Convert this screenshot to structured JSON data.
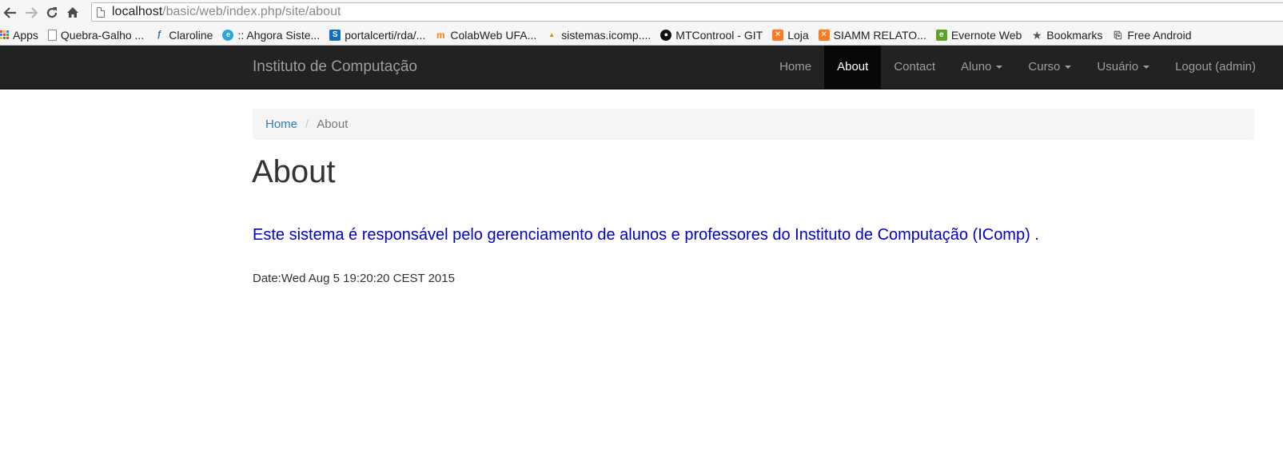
{
  "browser": {
    "url_host": "localhost",
    "url_path": "/basic/web/index.php/site/about",
    "nav_icons": [
      "back-arrow-icon",
      "forward-arrow-icon",
      "reload-icon",
      "home-icon"
    ]
  },
  "bookmarks": [
    {
      "label": "Apps",
      "icon": "apps-grid-icon"
    },
    {
      "label": "Quebra-Galho ...",
      "icon": "document-icon"
    },
    {
      "label": "Claroline",
      "icon": "claroline-icon"
    },
    {
      "label": ":: Ahgora Siste...",
      "icon": "ahgora-icon"
    },
    {
      "label": "portalcerti/rda/...",
      "icon": "sharepoint-icon"
    },
    {
      "label": "ColabWeb UFA...",
      "icon": "moodle-icon"
    },
    {
      "label": "sistemas.icomp....",
      "icon": "phpmyadmin-icon"
    },
    {
      "label": "MTControol - GIT",
      "icon": "github-icon"
    },
    {
      "label": "Loja",
      "icon": "xampp-icon"
    },
    {
      "label": "SIAMM RELATO...",
      "icon": "xampp-icon"
    },
    {
      "label": "Evernote Web",
      "icon": "evernote-icon"
    },
    {
      "label": "Bookmarks",
      "icon": "star-icon"
    },
    {
      "label": "Free Android",
      "icon": "free-android-icon"
    }
  ],
  "navbar": {
    "brand": "Instituto de Computação",
    "items": [
      {
        "label": "Home",
        "active": false,
        "dropdown": false
      },
      {
        "label": "About",
        "active": true,
        "dropdown": false
      },
      {
        "label": "Contact",
        "active": false,
        "dropdown": false
      },
      {
        "label": "Aluno",
        "active": false,
        "dropdown": true
      },
      {
        "label": "Curso",
        "active": false,
        "dropdown": true
      },
      {
        "label": "Usuário",
        "active": false,
        "dropdown": true
      },
      {
        "label": "Logout (admin)",
        "active": false,
        "dropdown": false
      }
    ]
  },
  "breadcrumb": {
    "home": "Home",
    "separator": "/",
    "current": "About"
  },
  "page": {
    "title": "About",
    "description": "Este sistema é responsável pelo gerenciamento de alunos e professores do Instituto de Computação (IComp) .",
    "date": "Date:Wed Aug 5 19:20:20 CEST 2015"
  },
  "colors": {
    "navbar_bg": "#222222",
    "navbar_active_bg": "#080808",
    "link": "#337ab7",
    "description_text": "#0000cc"
  }
}
